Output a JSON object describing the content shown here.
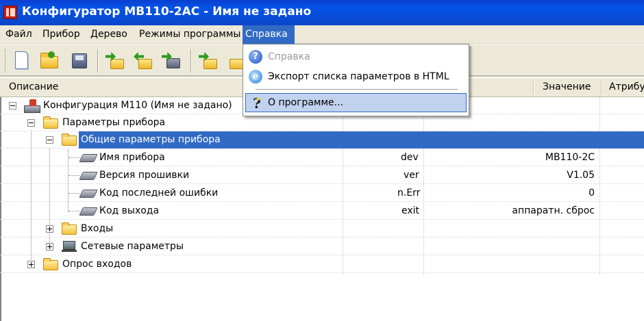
{
  "window": {
    "title": "Конфигуратор МВ110-2АС - Имя не задано"
  },
  "menubar": {
    "items": [
      {
        "label": "Файл"
      },
      {
        "label": "Прибор"
      },
      {
        "label": "Дерево"
      },
      {
        "label": "Режимы программы"
      },
      {
        "label": "Справка",
        "active": true
      }
    ]
  },
  "toolbar": {
    "icons": [
      "new-document-icon",
      "open-folder-icon",
      "save-disk-icon",
      "read-icon",
      "write-icon",
      "device-icon",
      "read-params-icon",
      "write-params-icon"
    ]
  },
  "dropdown": {
    "items": [
      {
        "label": "Справка",
        "disabled": true,
        "icon": "help-icon"
      },
      {
        "label": "Экспорт списка параметров в HTML",
        "icon": "ie-icon"
      },
      {
        "label": "О программе...",
        "icon": "about-icon",
        "hovered": true
      }
    ]
  },
  "header": {
    "columns": [
      "Описание",
      "Значение",
      "Атрибу"
    ]
  },
  "tree": {
    "root": "Конфигурация М110 (Имя не задано)",
    "device_params": "Параметры прибора",
    "general_params": "Общие параметры прибора",
    "rows": [
      {
        "label": "Имя прибора",
        "name": "dev",
        "value": "МВ110-2С"
      },
      {
        "label": "Версия прошивки",
        "name": "ver",
        "value": "V1.05"
      },
      {
        "label": "Код последней ошибки",
        "name": "n.Err",
        "value": "0"
      },
      {
        "label": "Код выхода",
        "name": "exit",
        "value": "аппаратн. сброс"
      }
    ],
    "inputs": "Входы",
    "network": "Сетевые параметры",
    "polling": "Опрос входов"
  }
}
